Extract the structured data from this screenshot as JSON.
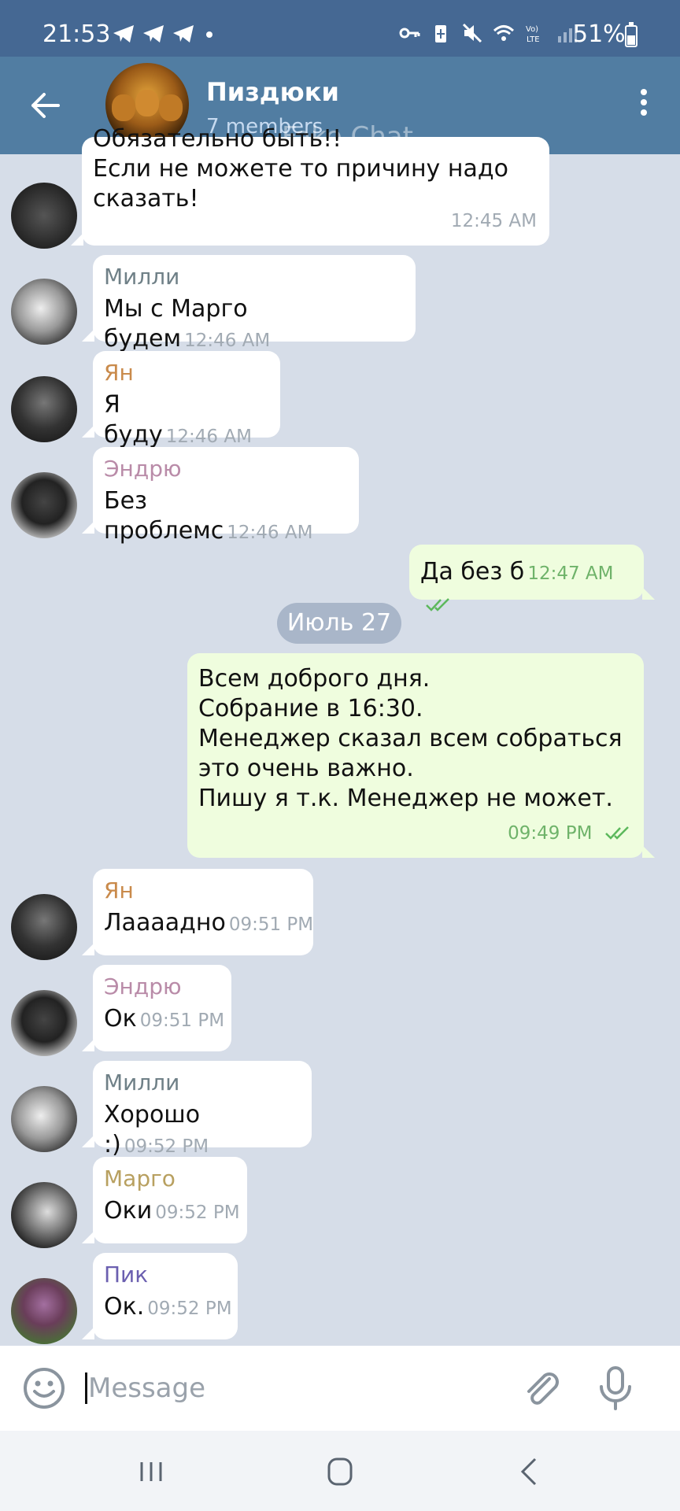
{
  "status_bar": {
    "time": "21:53",
    "battery": "51%",
    "icons": [
      "telegram-icon",
      "telegram-icon",
      "telegram-icon",
      "key-icon",
      "battery-saver-icon",
      "mute-icon",
      "wifi-icon",
      "volte-icon",
      "signal-icon"
    ]
  },
  "header": {
    "title": "Пиздюки",
    "subtitle": "7 members",
    "watermark": "Fake Chat"
  },
  "messages": [
    {
      "sender": "",
      "text": "Обязательно быть!!\nЕсли не можете то причину надо сказать!",
      "time": "12:45 AM"
    },
    {
      "sender": "Милли",
      "text": "Мы с Марго будем",
      "time": "12:46 AM"
    },
    {
      "sender": "Ян",
      "text": "Я буду",
      "time": "12:46 AM"
    },
    {
      "sender": "Эндрю",
      "text": "Без проблемс",
      "time": "12:46 AM"
    },
    {
      "sender": "",
      "text": "Да без б",
      "time": "12:47 AM"
    },
    {
      "sender": "",
      "text": "Всем доброго дня.\nСобрание в 16:30.\nМенеджер сказал всем собраться это очень важно.\nПишу я т.к. Менеджер не может.",
      "time": "09:49 PM"
    },
    {
      "sender": "Ян",
      "text": "Лаааадно",
      "time": "09:51 PM"
    },
    {
      "sender": "Эндрю",
      "text": "Ок",
      "time": "09:51 PM"
    },
    {
      "sender": "Милли",
      "text": "Хорошо :)",
      "time": "09:52 PM"
    },
    {
      "sender": "Марго",
      "text": "Оки",
      "time": "09:52 PM"
    },
    {
      "sender": "Пик",
      "text": "Ок.",
      "time": "09:52 PM"
    }
  ],
  "date_divider": "Июль 27",
  "colors": {
    "milli": "#6f8087",
    "yan": "#c98a4b",
    "andrew": "#b98ba8",
    "margo": "#b8a060",
    "pik": "#6b5fb0",
    "header_bg": "#517da2",
    "chat_bg": "#d6dde8",
    "outgoing_bubble": "#effdde"
  },
  "composer": {
    "placeholder": "Message"
  }
}
